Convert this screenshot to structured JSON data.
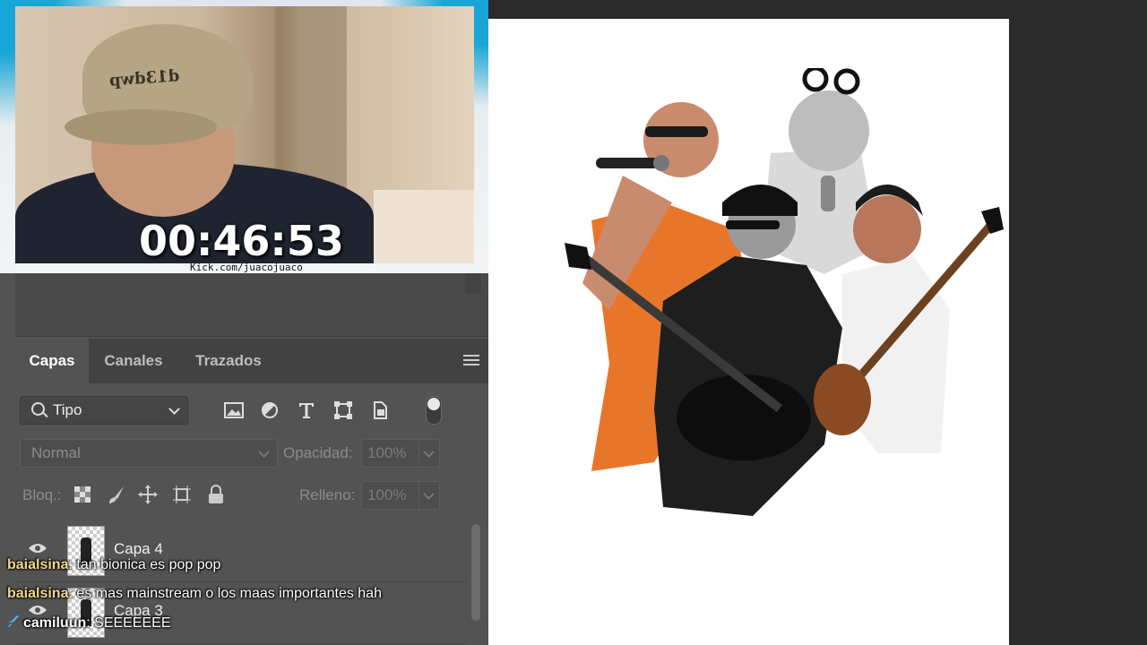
{
  "stream": {
    "timer": "00:46:53",
    "channel_url": "Kick.com/juacojuaco",
    "cap_text": "d13dwp"
  },
  "layers_panel": {
    "tabs": [
      {
        "label": "Capas",
        "active": true
      },
      {
        "label": "Canales",
        "active": false
      },
      {
        "label": "Trazados",
        "active": false
      }
    ],
    "filter": {
      "value": "Tipo"
    },
    "blend_mode": "Normal",
    "opacity_label": "Opacidad:",
    "opacity_value": "100%",
    "lock_label": "Bloq.:",
    "fill_label": "Relleno:",
    "fill_value": "100%",
    "layers": [
      {
        "name": "Capa 4",
        "visible": true
      },
      {
        "name": "Capa 3",
        "visible": true
      }
    ]
  },
  "chat": [
    {
      "user": "baialsina",
      "message": "tan bionica es pop pop",
      "user_color": "#f2d98a",
      "badge": null
    },
    {
      "user": "baialsina",
      "message": "es mas mainstream o los maas importantes hah",
      "user_color": "#f2d98a",
      "badge": null
    },
    {
      "user": "camiluun",
      "message": "SEEEEEEE",
      "user_color": "#ffffff",
      "badge": "sword-icon"
    }
  ],
  "colors": {
    "accent_cyan": "#19a6d6",
    "panel_bg": "#535353",
    "canvas_bg": "#ffffff",
    "workspace_bg": "#2b2b2b"
  }
}
